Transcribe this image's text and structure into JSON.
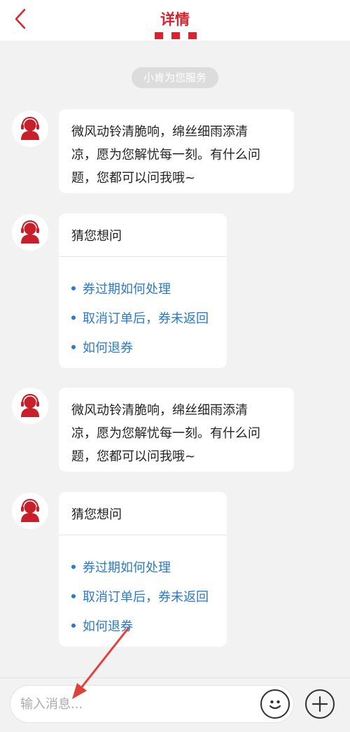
{
  "header": {
    "back_icon": "chevron-left-icon",
    "title": "详情",
    "accent_color": "#d9232e"
  },
  "service_label": "小肯为您服务",
  "messages": [
    {
      "type": "text",
      "avatar_icon": "agent-avatar-icon",
      "lines": [
        "微风动铃清脆响，绵丝细雨添清",
        "凉，愿为您解忧每一刻。有什么问",
        "题，您都可以问我哦~"
      ]
    },
    {
      "type": "suggestions",
      "avatar_icon": "agent-avatar-icon",
      "title": "猜您想问",
      "items": [
        "券过期如何处理",
        "取消订单后，券未返回",
        "如何退券"
      ]
    },
    {
      "type": "text",
      "avatar_icon": "agent-avatar-icon",
      "lines": [
        "微风动铃清脆响，绵丝细雨添清",
        "凉，愿为您解忧每一刻。有什么问",
        "题，您都可以问我哦~"
      ]
    },
    {
      "type": "suggestions",
      "avatar_icon": "agent-avatar-icon",
      "title": "猜您想问",
      "items": [
        "券过期如何处理",
        "取消订单后，券未返回",
        "如何退券"
      ]
    }
  ],
  "input": {
    "placeholder": "输入消息...",
    "value": "",
    "emoji_icon": "emoji-icon",
    "plus_icon": "plus-icon"
  },
  "link_color": "#2b79c9",
  "annotation_color": "#e0403a"
}
